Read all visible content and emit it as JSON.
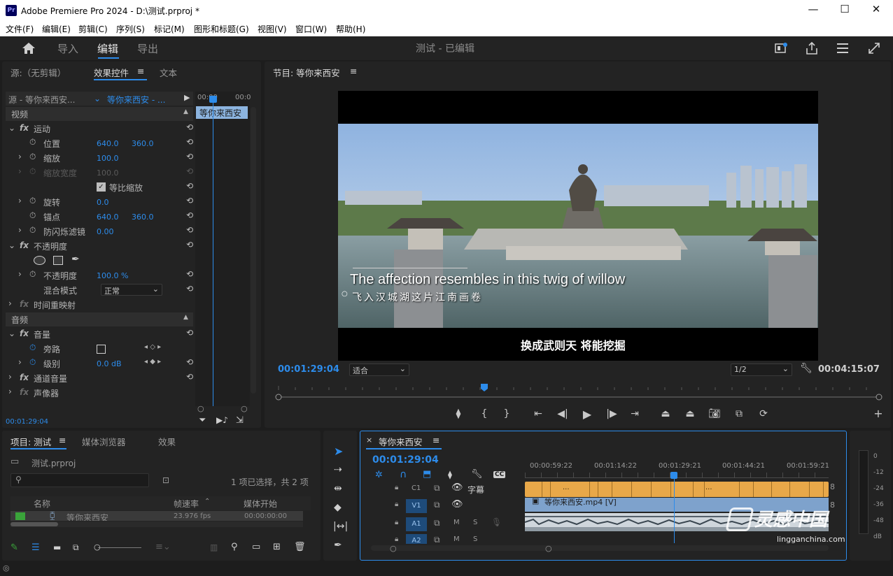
{
  "window": {
    "title": "Adobe Premiere Pro 2024 - D:\\测试.prproj *",
    "app_icon": "Pr",
    "min": "—",
    "max": "☐",
    "close": "✕"
  },
  "menu": [
    "文件(F)",
    "编辑(E)",
    "剪辑(C)",
    "序列(S)",
    "标记(M)",
    "图形和标题(G)",
    "视图(V)",
    "窗口(W)",
    "帮助(H)"
  ],
  "workspace": {
    "tabs": [
      "导入",
      "编辑",
      "导出"
    ],
    "active": "编辑",
    "project_title": "测试 - 已编辑"
  },
  "effect_panel": {
    "tabs": [
      "源:（无剪辑）",
      "效果控件",
      "文本"
    ],
    "source": "源 - 等你来西安...",
    "clip": "等你来西安 - ...",
    "mini_times": [
      "00:00",
      "00:0"
    ],
    "clip_bar": "等你来西安",
    "section_video": "视频",
    "section_audio": "音频",
    "motion": "运动",
    "position": "位置",
    "pos_x": "640.0",
    "pos_y": "360.0",
    "scale": "缩放",
    "scale_val": "100.0",
    "scale_width": "缩放宽度",
    "scale_width_val": "100.0",
    "uniform_scale": "等比缩放",
    "rotation": "旋转",
    "rotation_val": "0.0",
    "anchor": "锚点",
    "anchor_x": "640.0",
    "anchor_y": "360.0",
    "anti_flicker": "防闪烁滤镜",
    "anti_flicker_val": "0.00",
    "opacity": "不透明度",
    "opacity_prop": "不透明度",
    "opacity_val": "100.0 %",
    "blend_mode": "混合模式",
    "blend_val": "正常",
    "time_remap": "时间重映射",
    "volume": "音量",
    "bypass": "旁路",
    "level": "级别",
    "level_val": "0.0 dB",
    "channel_volume": "通道音量",
    "panner": "声像器",
    "timecode": "00:01:29:04"
  },
  "program": {
    "title": "节目: 等你来西安",
    "subtitle_en": "The affection resembles in this twig of willow",
    "subtitle_cn": "飞入汉城湖这片江南画卷",
    "caption": "换成武则天 将能挖掘",
    "timecode": "00:01:29:04",
    "fit": "适合",
    "resolution": "1/2",
    "duration": "00:04:15:07"
  },
  "project": {
    "tabs": [
      "项目: 测试",
      "媒体浏览器",
      "效果"
    ],
    "file": "测试.prproj",
    "selection": "1 项已选择，共 2 项",
    "cols": [
      "名称",
      "帧速率",
      "媒体开始"
    ],
    "item": {
      "name": "等你来西安",
      "fps": "23.976 fps",
      "start": "00:00:00:00"
    }
  },
  "timeline": {
    "title": "等你来西安",
    "timecode": "00:01:29:04",
    "ruler": [
      "00:00:59:22",
      "00:01:14:22",
      "00:01:29:21",
      "00:01:44:21",
      "00:01:59:21"
    ],
    "tracks": [
      {
        "id": "C1",
        "name": "字幕"
      },
      {
        "id": "V1",
        "name": ""
      },
      {
        "id": "A1",
        "name": ""
      },
      {
        "id": "A2",
        "name": ""
      }
    ],
    "clip_label": "等你来西安.mp4 [V]",
    "seg_dots": "...",
    "meter": [
      "0",
      "-12",
      "-24",
      "-36",
      "-48",
      "dB"
    ]
  },
  "watermark": {
    "cn": "灵感中国",
    "en": "lingganchina.com"
  }
}
